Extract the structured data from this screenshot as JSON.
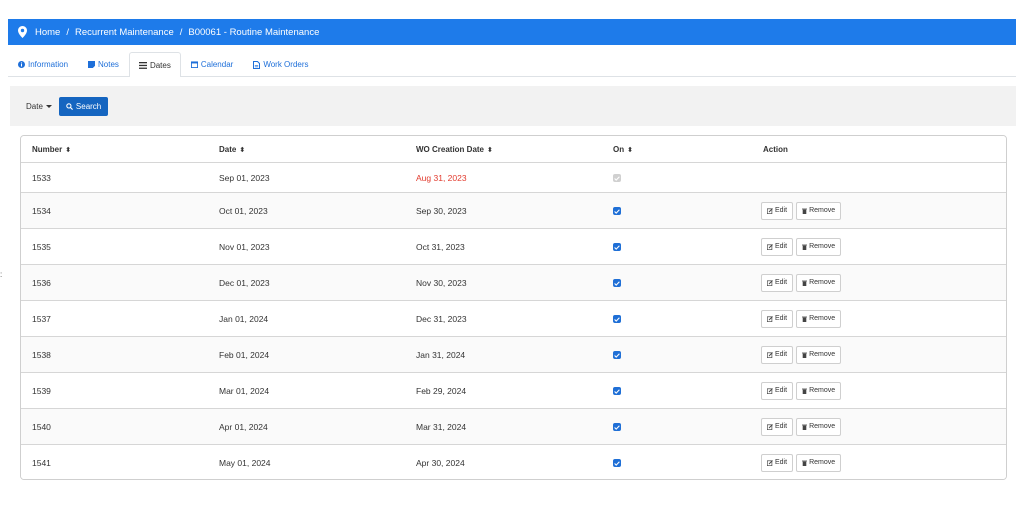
{
  "breadcrumb": [
    "Home",
    "Recurrent Maintenance",
    "B00061 - Routine Maintenance"
  ],
  "breadcrumb_separator": "/",
  "colors": {
    "primary": "#1e7bea",
    "link": "#1e6fd9",
    "overdue": "#e23b2e",
    "search": "#1565c0"
  },
  "tabs": [
    {
      "label": "Information",
      "icon": "info-icon",
      "active": false
    },
    {
      "label": "Notes",
      "icon": "note-icon",
      "active": false
    },
    {
      "label": "Dates",
      "icon": "list-icon",
      "active": true
    },
    {
      "label": "Calendar",
      "icon": "calendar-icon",
      "active": false
    },
    {
      "label": "Work Orders",
      "icon": "file-icon",
      "active": false
    }
  ],
  "filter": {
    "date_label": "Date",
    "search_label": "Search"
  },
  "table": {
    "headers": {
      "number": "Number",
      "date": "Date",
      "wo": "WO Creation Date",
      "on": "On",
      "action": "Action"
    },
    "edit_label": "Edit",
    "remove_label": "Remove",
    "rows": [
      {
        "number": "1533",
        "date": "Sep 01, 2023",
        "wo": "Aug 31, 2023",
        "overdue": true,
        "on": true,
        "disabled": true,
        "actions": false
      },
      {
        "number": "1534",
        "date": "Oct 01, 2023",
        "wo": "Sep 30, 2023",
        "overdue": false,
        "on": true,
        "disabled": false,
        "actions": true
      },
      {
        "number": "1535",
        "date": "Nov 01, 2023",
        "wo": "Oct 31, 2023",
        "overdue": false,
        "on": true,
        "disabled": false,
        "actions": true
      },
      {
        "number": "1536",
        "date": "Dec 01, 2023",
        "wo": "Nov 30, 2023",
        "overdue": false,
        "on": true,
        "disabled": false,
        "actions": true
      },
      {
        "number": "1537",
        "date": "Jan 01, 2024",
        "wo": "Dec 31, 2023",
        "overdue": false,
        "on": true,
        "disabled": false,
        "actions": true
      },
      {
        "number": "1538",
        "date": "Feb 01, 2024",
        "wo": "Jan 31, 2024",
        "overdue": false,
        "on": true,
        "disabled": false,
        "actions": true
      },
      {
        "number": "1539",
        "date": "Mar 01, 2024",
        "wo": "Feb 29, 2024",
        "overdue": false,
        "on": true,
        "disabled": false,
        "actions": true
      },
      {
        "number": "1540",
        "date": "Apr 01, 2024",
        "wo": "Mar 31, 2024",
        "overdue": false,
        "on": true,
        "disabled": false,
        "actions": true
      },
      {
        "number": "1541",
        "date": "May 01, 2024",
        "wo": "Apr 30, 2024",
        "overdue": false,
        "on": true,
        "disabled": false,
        "actions": true
      }
    ]
  }
}
